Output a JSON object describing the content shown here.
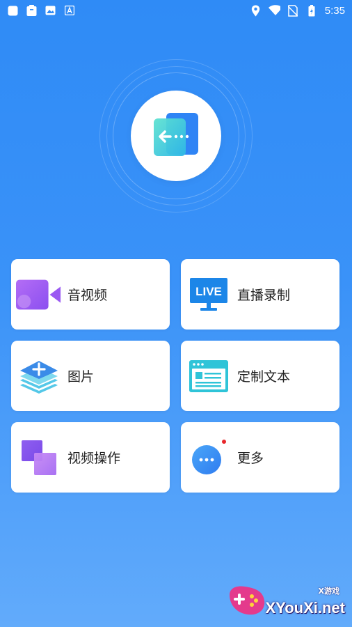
{
  "status_bar": {
    "time": "5:35",
    "left_icons": [
      "square-icon",
      "clipboard-icon",
      "image-icon",
      "font-icon"
    ],
    "right_icons": [
      "location-icon",
      "wifi-icon",
      "no-sim-icon",
      "battery-icon"
    ]
  },
  "hero": {
    "icon": "transfer-screen-icon",
    "accent": "#2f8bf6"
  },
  "features": [
    {
      "label": "音视频",
      "icon": "video-camera-icon"
    },
    {
      "label": "直播录制",
      "icon": "live-monitor-icon",
      "badge_text": "LIVE"
    },
    {
      "label": "图片",
      "icon": "image-layers-icon"
    },
    {
      "label": "定制文本",
      "icon": "browser-text-icon"
    },
    {
      "label": "视频操作",
      "icon": "overlap-squares-icon"
    },
    {
      "label": "更多",
      "icon": "more-dots-icon",
      "has_notification_dot": true
    }
  ],
  "watermark": {
    "text": "XYouXi.net",
    "small_text": "X游戏"
  }
}
